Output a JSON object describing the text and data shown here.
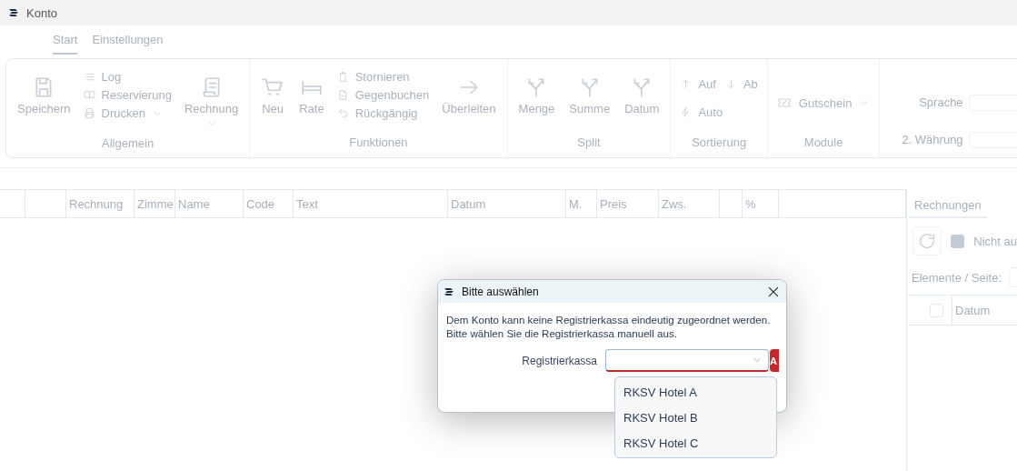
{
  "window": {
    "title": "Konto"
  },
  "background_disabled": true,
  "tabs": [
    {
      "label": "Start",
      "selected": true
    },
    {
      "label": "Einstellungen",
      "selected": false
    }
  ],
  "ribbon": {
    "groups": [
      {
        "kind": "buttons",
        "label": "Allgemein",
        "items": [
          {
            "kind": "large",
            "label": "Speichern"
          },
          {
            "kind": "stack",
            "items": [
              {
                "label": "Log"
              },
              {
                "label": "Reservierung"
              },
              {
                "label": "Drucken",
                "menu": true
              }
            ]
          },
          {
            "kind": "large",
            "label": "Rechnung",
            "menu": true
          }
        ]
      },
      {
        "kind": "buttons",
        "label": "Funktionen",
        "items": [
          {
            "kind": "large",
            "label": "Neu"
          },
          {
            "kind": "large",
            "label": "Rate"
          },
          {
            "kind": "stack",
            "items": [
              {
                "label": "Stornieren"
              },
              {
                "label": "Gegenbuchen"
              },
              {
                "label": "Rückgängig"
              }
            ]
          },
          {
            "kind": "large",
            "label": "Überleiten"
          }
        ]
      },
      {
        "kind": "buttons",
        "label": "Split",
        "items": [
          {
            "kind": "large",
            "label": "Menge"
          },
          {
            "kind": "large",
            "label": "Summe"
          },
          {
            "kind": "large",
            "label": "Datum"
          }
        ]
      },
      {
        "kind": "buttons",
        "label": "Sortierung",
        "items": [
          {
            "kind": "sort",
            "items": [
              {
                "label": "Auf"
              },
              {
                "label": "Ab"
              },
              {
                "label": "Auto"
              }
            ]
          }
        ]
      },
      {
        "kind": "buttons",
        "label": "Module",
        "items": [
          {
            "kind": "inline",
            "label": "Gutschein",
            "menu": true
          }
        ]
      },
      {
        "kind": "form",
        "fields": [
          {
            "label": "Sprache"
          },
          {
            "label": "2. Währung"
          }
        ]
      }
    ]
  },
  "table": {
    "columns": [
      {},
      {},
      {
        "label": "Rechnung"
      },
      {
        "label": "Zimme"
      },
      {
        "label": "Name"
      },
      {
        "label": "Code"
      },
      {
        "label": "Text"
      },
      {
        "label": "Datum"
      },
      {
        "label": "M."
      },
      {
        "label": "Preis"
      },
      {
        "label": "Zws."
      },
      {},
      {
        "label": "%"
      },
      {}
    ]
  },
  "side_panel": {
    "tabs": [
      {
        "label": "Rechnungen",
        "selected": true
      }
    ],
    "filter": {
      "label": "Nicht au",
      "checked": true
    },
    "page_size_label": "Elemente / Seite:",
    "header_checkbox": {
      "checked": false
    },
    "columns": [
      {
        "label": "Datum"
      }
    ]
  },
  "dialog": {
    "title": "Bitte auswählen",
    "message": "Dem Konto kann keine Registrierkassa eindeutig zugeordnet werden.\nBitte wählen Sie die Registrierkassa manuell aus.",
    "field": {
      "label": "Registrierkassa",
      "invalid": true,
      "expanded": true
    },
    "badge": "A",
    "options": [
      {
        "label": "RKSV Hotel A",
        "selected": false
      },
      {
        "label": "RKSV Hotel B",
        "selected": false
      },
      {
        "label": "RKSV Hotel C",
        "selected": false
      }
    ]
  }
}
